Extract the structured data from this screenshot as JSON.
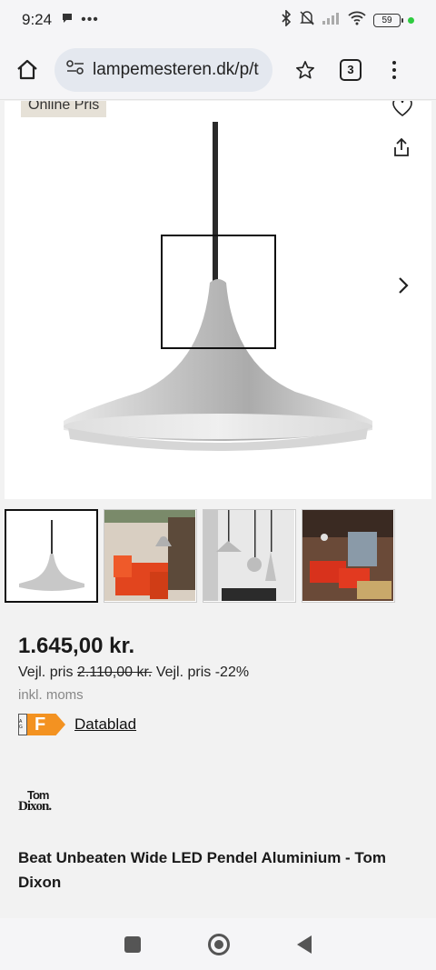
{
  "status": {
    "time": "9:24",
    "battery": "59"
  },
  "browser": {
    "url": "lampemesteren.dk/p/t",
    "tab_count": "3"
  },
  "product": {
    "badge": "Online Pris",
    "price": "1.645,00 kr.",
    "vejl_prefix": "Vejl. pris",
    "old_price": "2.110,00 kr.",
    "discount": "Vejl. pris -22%",
    "vat_note": "inkl. moms",
    "energy_grade": "F",
    "energy_scale": "A G",
    "datasheet_label": "Datablad",
    "brand_line1": "Tom",
    "brand_line2": "Dixon.",
    "title": "Beat Unbeaten Wide LED Pendel Aluminium - Tom Dixon"
  },
  "colors": {
    "energy_orange": "#f39221",
    "lamp_silver": "#c7c7c7"
  },
  "thumbnails": [
    {
      "name": "thumb-lamp-product"
    },
    {
      "name": "thumb-living-room-red-sofa"
    },
    {
      "name": "thumb-three-pendants"
    },
    {
      "name": "thumb-red-lounge"
    }
  ]
}
